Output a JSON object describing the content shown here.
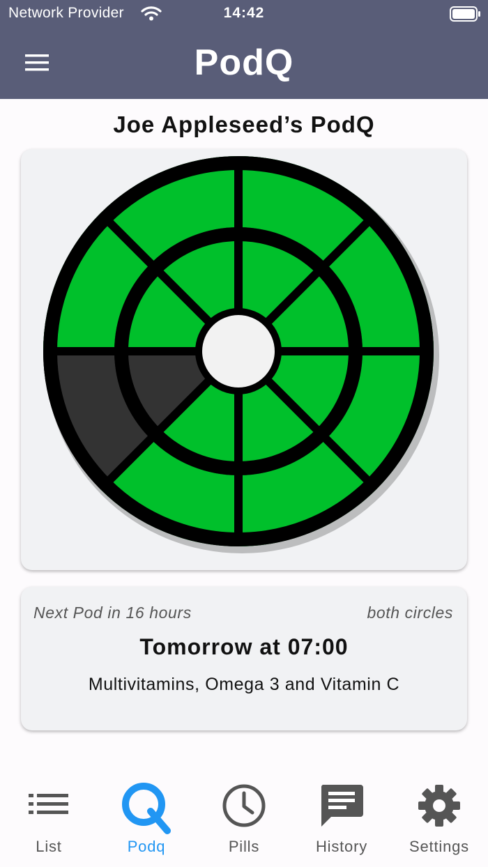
{
  "status_bar": {
    "carrier": "Network Provider",
    "time": "14:42"
  },
  "header": {
    "title": "PodQ",
    "menu_icon": "hamburger-menu-icon",
    "bg_color": "#595d78"
  },
  "page_title": "Joe Appleseed’s PodQ",
  "pod_wheel": {
    "outer_ring": [
      "full",
      "full",
      "full",
      "full",
      "full",
      "empty",
      "full",
      "full"
    ],
    "inner_ring": [
      "full",
      "full",
      "full",
      "full",
      "full",
      "empty",
      "full",
      "full"
    ],
    "full_color": "#00c02b",
    "empty_color": "#333333",
    "center_color": "#f2f2f2"
  },
  "next_pod": {
    "due_text": "Next Pod in 16 hours",
    "circles_text": "both circles",
    "time_text": "Tomorrow at 07:00",
    "pills_text": "Multivitamins, Omega 3 and Vitamin C"
  },
  "tabs": [
    {
      "label": "List",
      "icon": "list-icon"
    },
    {
      "label": "Podq",
      "icon": "podq-q-icon",
      "active": true
    },
    {
      "label": "Pills",
      "icon": "clock-icon"
    },
    {
      "label": "History",
      "icon": "chat-history-icon"
    },
    {
      "label": "Settings",
      "icon": "gear-icon"
    }
  ],
  "colors": {
    "accent": "#2196f3",
    "tab_inactive": "#555555"
  }
}
